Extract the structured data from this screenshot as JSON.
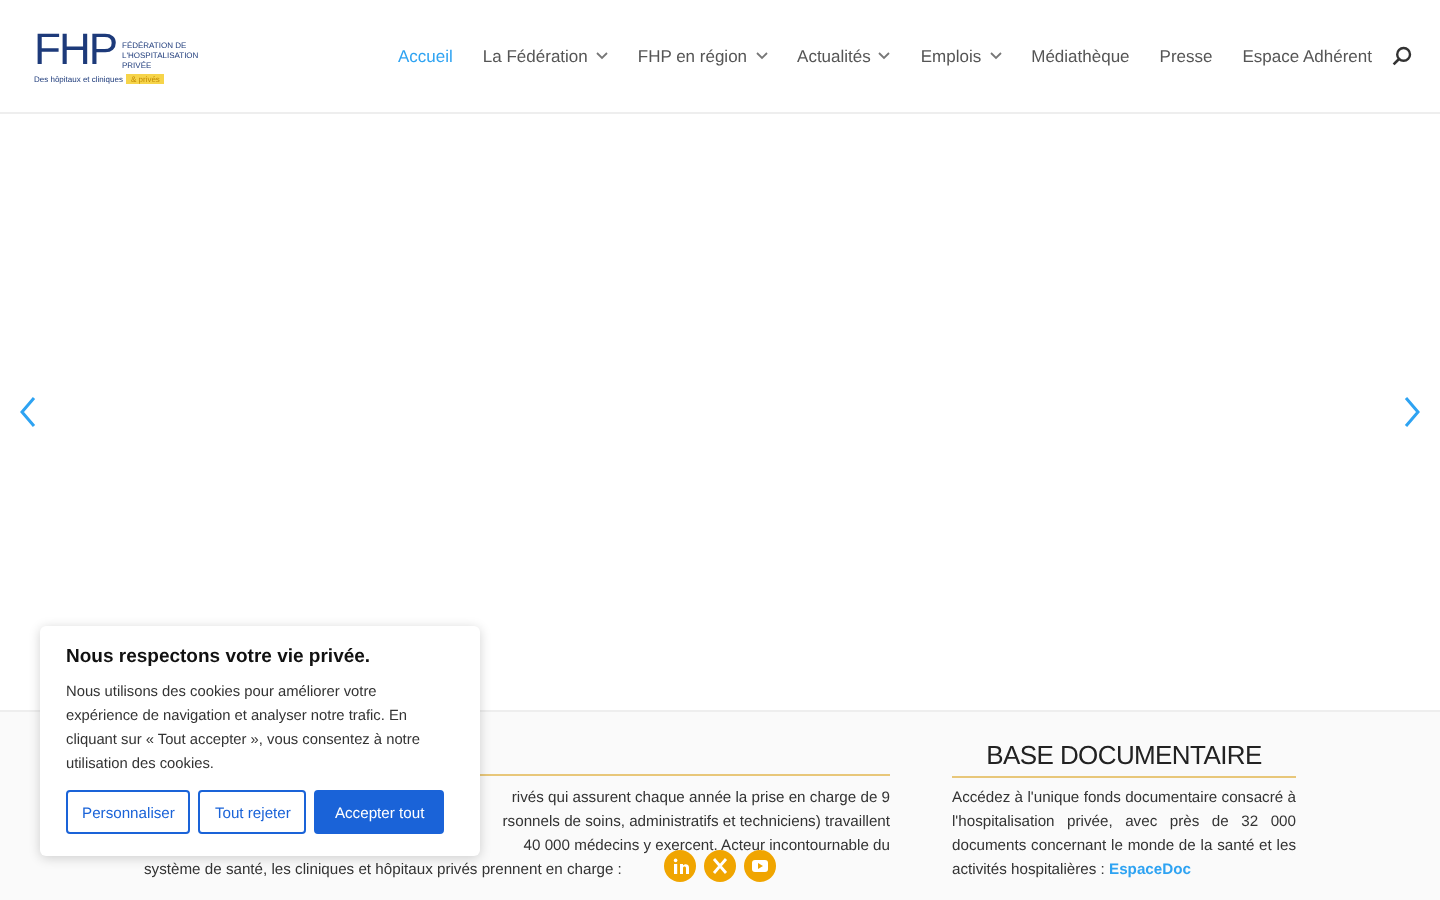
{
  "logo": {
    "mark": "FHP",
    "name": "FÉDÉRATION DE L'HOSPITALISATION PRIVÉE",
    "tagline": "Des hôpitaux et cliniques",
    "tagline_highlight": "& privés"
  },
  "nav": [
    {
      "label": "Accueil",
      "selected": true,
      "dropdown": false
    },
    {
      "label": "La Fédération",
      "selected": false,
      "dropdown": true
    },
    {
      "label": "FHP en région",
      "selected": false,
      "dropdown": true
    },
    {
      "label": "Actualités",
      "selected": false,
      "dropdown": true
    },
    {
      "label": "Emplois",
      "selected": false,
      "dropdown": true
    },
    {
      "label": "Médiathèque",
      "selected": false,
      "dropdown": false
    },
    {
      "label": "Presse",
      "selected": false,
      "dropdown": false
    },
    {
      "label": "Espace Adhérent",
      "selected": false,
      "dropdown": false
    }
  ],
  "left_column": {
    "lines": [
      "rivés qui assurent chaque année la prise en charge de 9",
      "rsonnels de soins, administratifs et techniciens) travaillent",
      "40 000 médecins y exercent. Acteur incontournable du",
      "système de santé, les cliniques et hôpitaux privés prennent en charge :"
    ]
  },
  "right_column": {
    "title": "BASE DOCUMENTAIRE",
    "text": "Accédez à l'unique fonds documentaire consacré à l'hospitalisation privée, avec près de 32 000 documents concernant le monde de la santé et les activités hospitalières : ",
    "link": "EspaceDoc"
  },
  "social": [
    {
      "kind": "linkedin"
    },
    {
      "kind": "x"
    },
    {
      "kind": "youtube"
    }
  ],
  "cookie_banner": {
    "title": "Nous respectons votre vie privée.",
    "text": "Nous utilisons des cookies pour améliorer votre expérience de navigation et analyser notre trafic. En cliquant sur « Tout accepter », vous consentez à notre utilisation des cookies.",
    "buttons": [
      {
        "label": "Personnaliser",
        "kind": "outline"
      },
      {
        "label": "Tout rejeter",
        "kind": "outline"
      },
      {
        "label": "Accepter tout",
        "kind": "primary"
      }
    ]
  }
}
